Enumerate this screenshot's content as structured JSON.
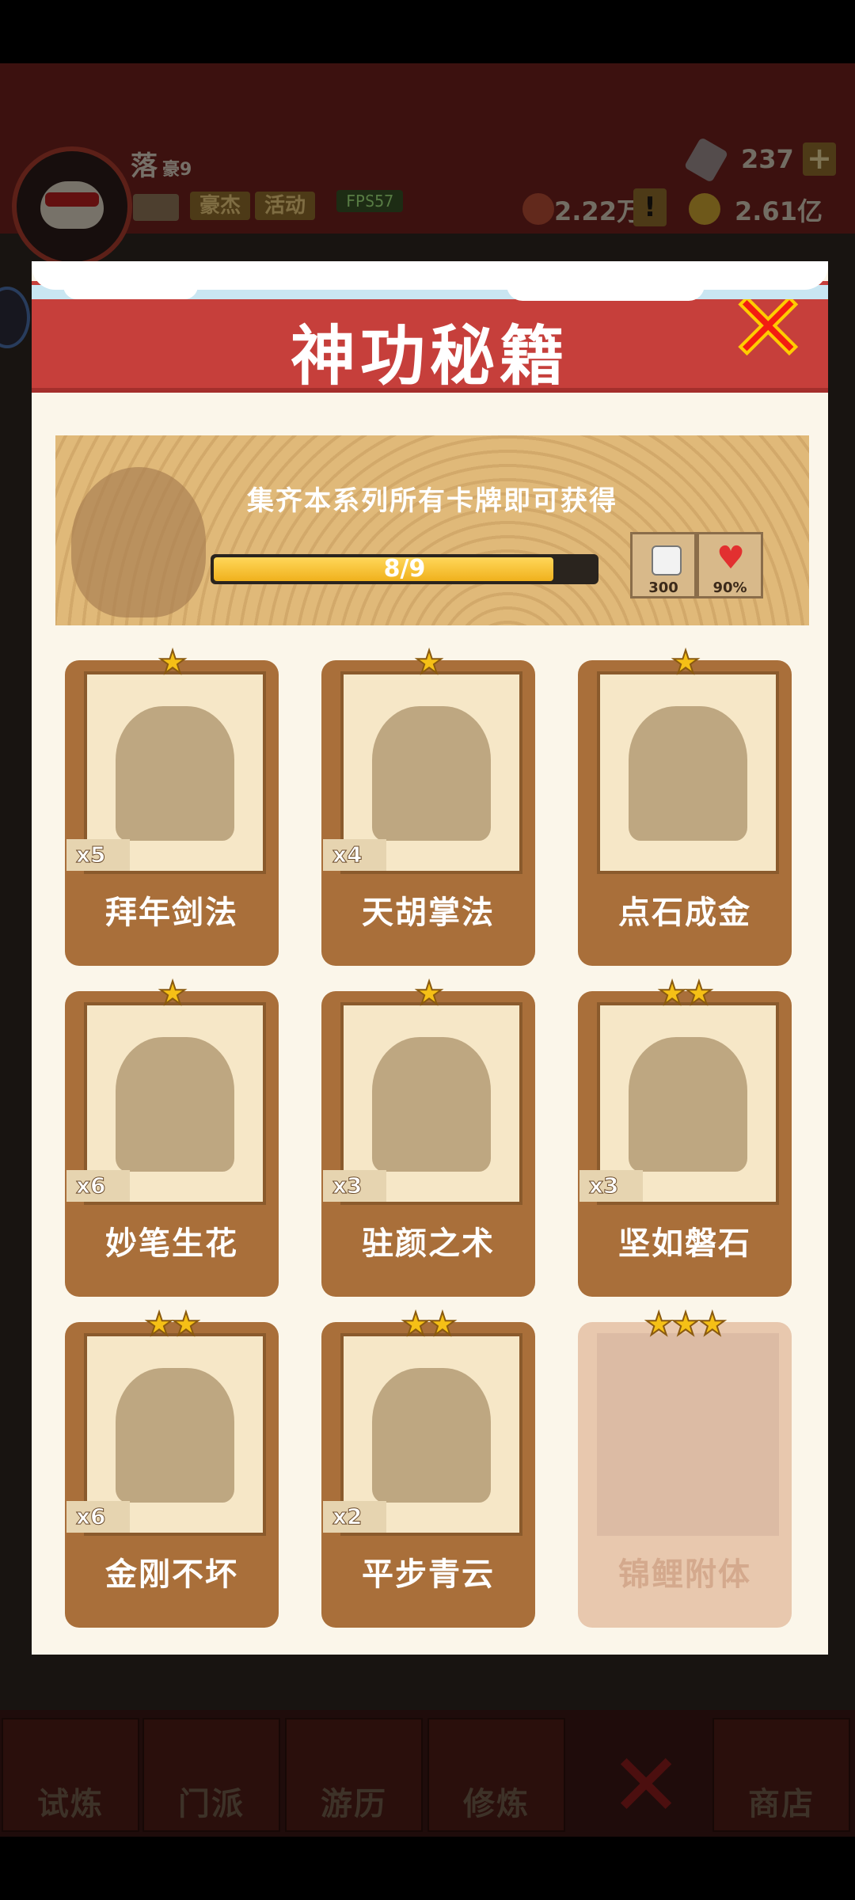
{
  "hud": {
    "player_name": "落",
    "player_level": "豪9",
    "tags": [
      "豪杰",
      "活动"
    ],
    "fps": "FPS57",
    "gems": "237",
    "resource1": "2.22万",
    "resource2": "2.61亿"
  },
  "modal": {
    "title": "神功秘籍",
    "banner_text": "集齐本系列所有卡牌即可获得",
    "progress_text": "8/9",
    "progress_fraction": 0.89,
    "rewards": [
      {
        "icon": "dice-icon",
        "value": "300"
      },
      {
        "icon": "heart-icon",
        "value": "90%"
      }
    ],
    "cards": [
      {
        "name": "拜年剑法",
        "count": "x5",
        "stars": "★"
      },
      {
        "name": "天胡掌法",
        "count": "x4",
        "stars": "★"
      },
      {
        "name": "点石成金",
        "count": "",
        "stars": "★"
      },
      {
        "name": "妙笔生花",
        "count": "x6",
        "stars": "★"
      },
      {
        "name": "驻颜之术",
        "count": "x3",
        "stars": "★"
      },
      {
        "name": "坚如磐石",
        "count": "x3",
        "stars": "★★"
      },
      {
        "name": "金刚不坏",
        "count": "x6",
        "stars": "★★"
      },
      {
        "name": "平步青云",
        "count": "x2",
        "stars": "★★"
      },
      {
        "name": "锦鲤附体",
        "count": "",
        "stars": "★★★"
      }
    ]
  },
  "nav": {
    "items": [
      "试炼",
      "门派",
      "游历",
      "修炼",
      "商店"
    ]
  },
  "colors": {
    "header_red": "#c63f3b",
    "card_brown": "#a96f3a",
    "star_gold": "#f5c016"
  }
}
